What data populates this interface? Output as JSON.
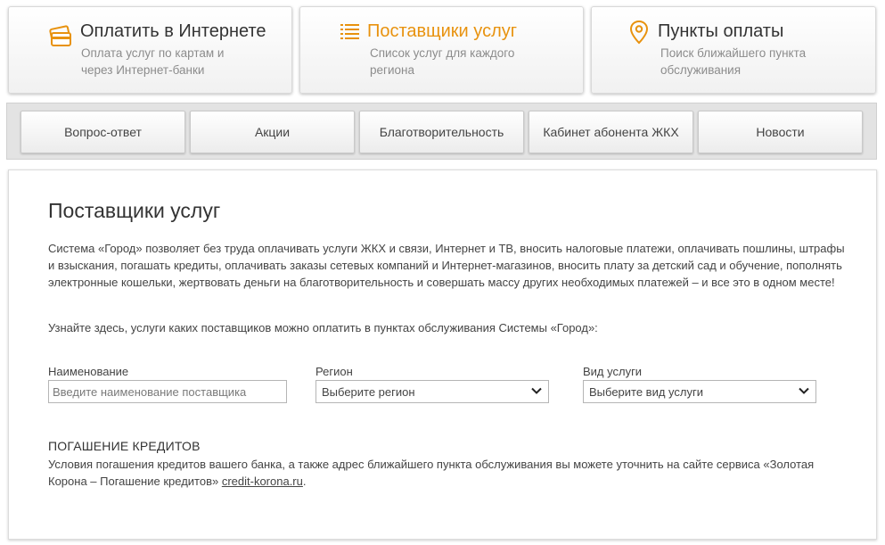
{
  "top_cards": [
    {
      "title": "Оплатить в Интернете",
      "subtitle": "Оплата услуг по картам и через Интернет-банки",
      "icon": "card-icon"
    },
    {
      "title": "Поставщики услуг",
      "subtitle": "Список услуг для каждого региона",
      "icon": "list-icon"
    },
    {
      "title": "Пункты оплаты",
      "subtitle": "Поиск ближайшего пункта обслуживания",
      "icon": "map-pin-icon"
    }
  ],
  "nav": {
    "items": [
      "Вопрос-ответ",
      "Акции",
      "Благотворительность",
      "Кабинет абонента ЖКХ",
      "Новости"
    ]
  },
  "main": {
    "title": "Поставщики услуг",
    "intro": "Система «Город» позволяет без труда оплачивать услуги ЖКХ и связи, Интернет и ТВ, вносить налоговые платежи, оплачивать пошлины, штрафы и взыскания, погашать кредиты, оплачивать заказы сетевых компаний и Интернет-магазинов, вносить плату за детский сад и обучение, пополнять электронные кошельки, жертвовать деньги на благотворительность и совершать массу других необходимых платежей – и все это в одном месте!",
    "lookup_text": "Узнайте здесь, услуги каких поставщиков можно оплатить в пунктах обслуживания Системы «Город»:",
    "filters": {
      "name_label": "Наименование",
      "name_placeholder": "Введите наименование поставщика",
      "region_label": "Регион",
      "region_value": "Выберите регион",
      "service_label": "Вид услуги",
      "service_value": "Выберите вид услуги"
    },
    "credit": {
      "title": "ПОГАШЕНИЕ КРЕДИТОВ",
      "text": "Условия погашения кредитов вашего банка, а также адрес ближайшего пункта обслуживания вы можете уточнить на сайте сервиса «Золотая Корона – Погашение кредитов» ",
      "link": "credit-korona.ru",
      "after": "."
    }
  },
  "colors": {
    "accent": "#e8920e",
    "nav_bg": "#e3e3e3",
    "text": "#333333"
  }
}
